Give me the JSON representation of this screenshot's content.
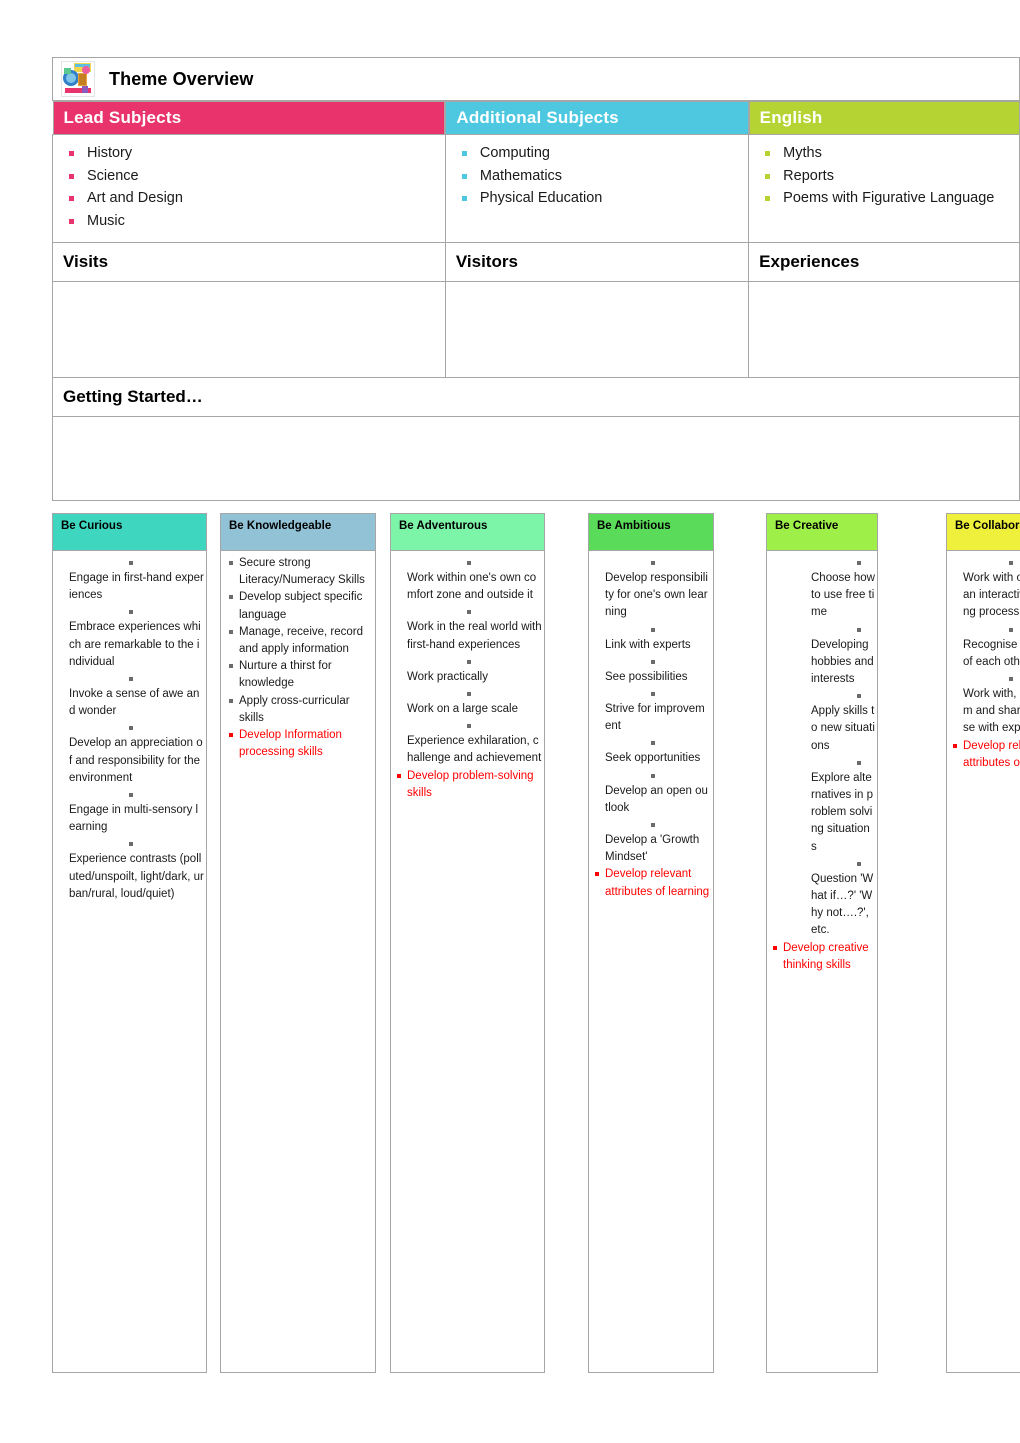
{
  "document": {
    "title": "Theme Overview",
    "icon_name": "theme-illustration-icon"
  },
  "colors": {
    "lead_subjects": "#E8336D",
    "additional_subjects": "#4DC8E0",
    "english": "#B5D433",
    "be_curious": "#3FD6C0",
    "be_knowledgeable": "#92C2D6",
    "be_adventurous": "#7DF5A8",
    "be_ambitious": "#5ADC5A",
    "be_creative": "#9EF048",
    "be_collaborative": "#EFF03C",
    "red_text": "#FF0000",
    "border": "#A6A6A6"
  },
  "subjects": {
    "lead": {
      "heading": "Lead Subjects",
      "items": [
        "History",
        "Science",
        "Art and Design",
        "Music"
      ]
    },
    "additional": {
      "heading": "Additional Subjects",
      "items": [
        "Computing",
        "Mathematics",
        "Physical Education"
      ]
    },
    "english": {
      "heading": "English",
      "items": [
        "Myths",
        "Reports",
        "Poems with Figurative Language"
      ]
    }
  },
  "planning": {
    "visits_heading": "Visits",
    "visitors_heading": "Visitors",
    "experiences_heading": "Experiences",
    "visits_content": "",
    "visitors_content": "",
    "experiences_content": "",
    "getting_started_heading": "Getting Started…",
    "getting_started_content": ""
  },
  "attributes": [
    {
      "heading": "Be Curious",
      "color": "#3FD6C0",
      "wrap": "narrow",
      "items": [
        {
          "text": "Engage in first-hand experiences",
          "red": false
        },
        {
          "text": "Embrace experiences which are remarkable to the individual",
          "red": false
        },
        {
          "text": "Invoke a sense of awe and wonder",
          "red": false
        },
        {
          "text": "Develop an appreciation of and responsibility for the environment",
          "red": false
        },
        {
          "text": "Engage in multi-sensory learning",
          "red": false
        },
        {
          "text": "Experience contrasts (polluted/unspoilt, light/dark, urban/rural, loud/quiet)",
          "red": false
        }
      ]
    },
    {
      "heading": "Be Knowledgeable",
      "color": "#92C2D6",
      "wrap": "normal",
      "items": [
        {
          "text": "Secure strong Literacy/Numeracy Skills",
          "red": false
        },
        {
          "text": "Develop subject specific language",
          "red": false
        },
        {
          "text": "Manage, receive, record and apply information",
          "red": false
        },
        {
          "text": "Nurture a thirst for knowledge",
          "red": false
        },
        {
          "text": "Apply cross-curricular skills",
          "red": false
        },
        {
          "text": "Develop Information processing skills",
          "red": true
        }
      ]
    },
    {
      "heading": "Be Adventurous",
      "color": "#7DF5A8",
      "wrap": "narrow",
      "items": [
        {
          "text": "Work within one's own comfort zone and outside it",
          "red": false
        },
        {
          "text": "Work in the real world with first-hand experiences",
          "red": false
        },
        {
          "text": "Work practically",
          "red": false
        },
        {
          "text": "Work on a large scale",
          "red": false
        },
        {
          "text": "Experience exhilaration, challenge and achievement",
          "red": false
        },
        {
          "text": "Develop problem-solving skills",
          "red": true
        }
      ]
    },
    {
      "heading": "Be Ambitious",
      "color": "#5ADC5A",
      "wrap": "narrow",
      "items": [
        {
          "text": "Develop responsibility for one's own learning",
          "red": false
        },
        {
          "text": "Link with experts",
          "red": false
        },
        {
          "text": "See possibilities",
          "red": false
        },
        {
          "text": "Strive for improvement",
          "red": false
        },
        {
          "text": "Seek opportunities",
          "red": false
        },
        {
          "text": "Develop an open outlook",
          "red": false
        },
        {
          "text": "Develop a 'Growth Mindset'",
          "red": false
        },
        {
          "text": "Develop relevant attributes of learning",
          "red": true
        }
      ]
    },
    {
      "heading": "Be Creative",
      "color": "#9EF048",
      "wrap": "narrow",
      "items": [
        {
          "text": "Choose how to use free time",
          "red": false
        },
        {
          "text": "Developing hobbies and interests",
          "red": false
        },
        {
          "text": "Apply skills to new situations",
          "red": false
        },
        {
          "text": "Explore alternatives in problem solving situations",
          "red": false
        },
        {
          "text": "Question 'What if…?' 'Why not….?', etc.",
          "red": false
        },
        {
          "text": "Develop creative thinking skills",
          "red": true
        }
      ]
    },
    {
      "heading": "Be Collaborative",
      "color": "#EFF03C",
      "wrap": "narrow",
      "items": [
        {
          "text": "Work with others in an interactive learning process",
          "red": false
        },
        {
          "text": "Recognise the value of each other",
          "red": false
        },
        {
          "text": "Work with, learn from and share expertise with experts",
          "red": false
        },
        {
          "text": "Develop relevant attributes of learning",
          "red": true
        }
      ]
    }
  ]
}
